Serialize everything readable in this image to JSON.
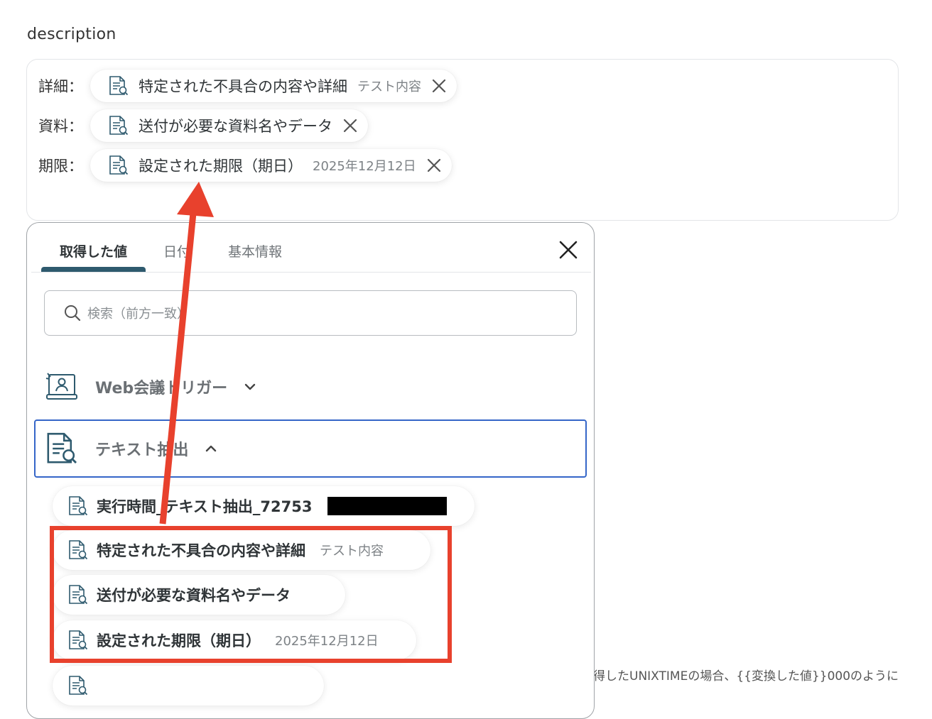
{
  "field": {
    "label": "description",
    "rows": [
      {
        "label": "詳細：",
        "chip": {
          "name": "特定された不具合の内容や詳細",
          "sample": "テスト内容"
        }
      },
      {
        "label": "資料：",
        "chip": {
          "name": "送付が必要な資料名やデータ",
          "sample": ""
        }
      },
      {
        "label": "期限：",
        "chip": {
          "name": "設定された期限（期日）",
          "sample": "2025年12月12日"
        }
      }
    ]
  },
  "panel": {
    "tabs": [
      "取得した値",
      "日付",
      "基本情報"
    ],
    "active_tab": 0,
    "search_placeholder": "検索（前方一致）",
    "groups": [
      {
        "name": "Web会議トリガー",
        "expanded": false
      },
      {
        "name": "テキスト抽出",
        "expanded": true
      }
    ],
    "items": [
      {
        "name": "実行時間_テキスト抽出_72753",
        "sample": "",
        "redacted": true
      },
      {
        "name": "特定された不具合の内容や詳細",
        "sample": "テスト内容"
      },
      {
        "name": "送付が必要な資料名やデータ",
        "sample": ""
      },
      {
        "name": "設定された期限（期日）",
        "sample": "2025年12月12日"
      }
    ]
  },
  "background_note": "得したUNIXTIMEの場合、{{変換した値}}000のように",
  "colors": {
    "accent": "#2e5a6e",
    "selection": "#3566c8",
    "annotation": "#e8412d"
  }
}
